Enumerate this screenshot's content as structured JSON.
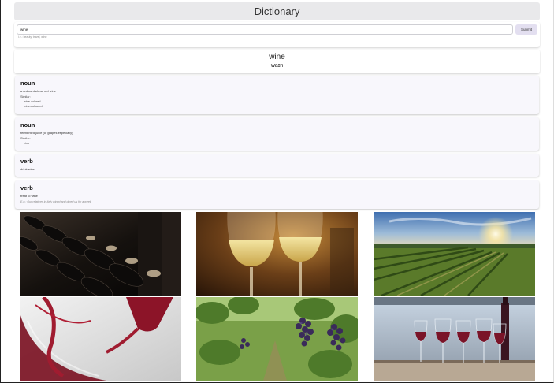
{
  "header": {
    "title": "Dictionary"
  },
  "search": {
    "value": "wine",
    "placeholder": "",
    "submit_label": "Submit",
    "hint": "i.e.: beauty, travel, wine"
  },
  "word": {
    "title": "wine",
    "phonetic": "waɪn"
  },
  "definitions": [
    {
      "pos": "noun",
      "text": "a red as dark as red wine",
      "similar_label": "Similar:",
      "similar": [
        "wine-colored",
        "wine-coloured"
      ]
    },
    {
      "pos": "noun",
      "text": "fermented juice (of grapes especially)",
      "similar_label": "Similar:",
      "similar": [
        "vino"
      ]
    },
    {
      "pos": "verb",
      "text": "drink wine"
    },
    {
      "pos": "verb",
      "text": "treat to wine",
      "example": "E.g.: Our relatives in Italy wined and dined us for a week"
    }
  ],
  "photos": [
    {
      "icon": "wine-cellar-bottles-photo"
    },
    {
      "icon": "white-wine-glasses-photo"
    },
    {
      "icon": "vineyard-sunset-photo"
    },
    {
      "icon": "red-wine-pour-photo"
    },
    {
      "icon": "grape-vines-photo"
    },
    {
      "icon": "red-wine-glasses-table-photo"
    }
  ],
  "colors": {
    "header_bg": "#e9e9eb",
    "submit_bg": "#e3dff0",
    "card_bg": "#f8f7fc"
  }
}
